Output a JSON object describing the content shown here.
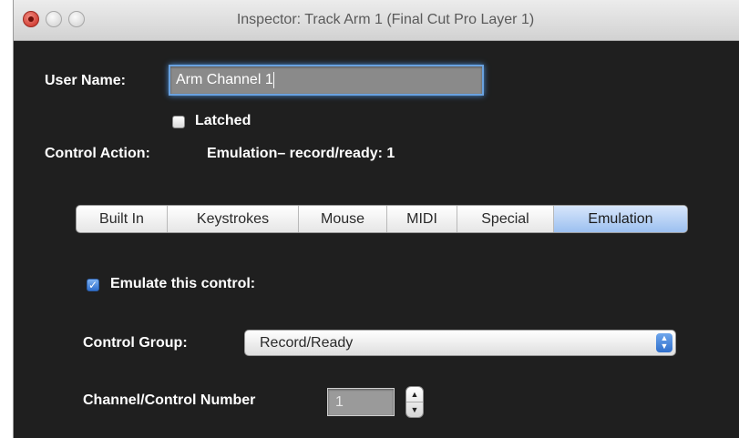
{
  "window": {
    "title": "Inspector: Track Arm 1 (Final Cut Pro Layer 1)",
    "controls": [
      "close",
      "minimize",
      "zoom"
    ]
  },
  "fields": {
    "user_name_label": "User Name:",
    "user_name_value": "Arm Channel 1",
    "latched_label": "Latched",
    "latched_checked": false,
    "control_action_label": "Control Action:",
    "control_action_value": "Emulation– record/ready: 1"
  },
  "tabs": [
    {
      "label": "Built In",
      "selected": false
    },
    {
      "label": "Keystrokes",
      "selected": false
    },
    {
      "label": "Mouse",
      "selected": false
    },
    {
      "label": "MIDI",
      "selected": false
    },
    {
      "label": "Special",
      "selected": false
    },
    {
      "label": "Emulation",
      "selected": true
    }
  ],
  "emulation": {
    "emulate_label": "Emulate this control:",
    "emulate_checked": true,
    "control_group_label": "Control Group:",
    "control_group_value": "Record/Ready",
    "channel_number_label": "Channel/Control Number",
    "channel_number_value": "1"
  },
  "icons": {
    "checkmark": "checkmark-icon",
    "popup_arrows": "up-down-arrows-icon",
    "stepper": "stepper-arrows-icon"
  },
  "colors": {
    "panel_bg": "#1f1f1f",
    "focus_ring": "#6aa2e0",
    "selected_tab": "#9cc0f0",
    "accent_blue": "#2f6fcc",
    "close_red": "#c8281d"
  }
}
